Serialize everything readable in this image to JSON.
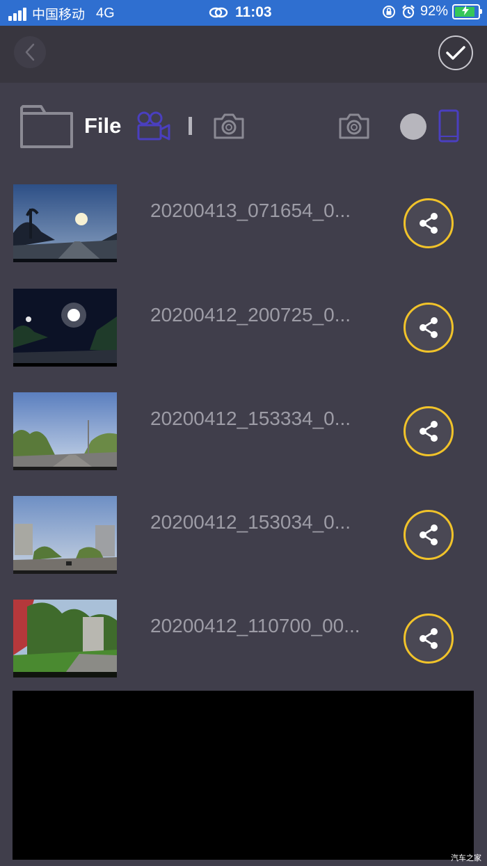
{
  "status_bar": {
    "carrier": "中国移动",
    "network": "4G",
    "time": "11:03",
    "battery": "92%",
    "battery_level": 0.92,
    "icons": [
      "signal-icon",
      "link-icon",
      "rotation-lock-icon",
      "alarm-icon",
      "battery-icon"
    ]
  },
  "nav": {
    "icons": [
      "back-chevron-icon",
      "checkmark-icon"
    ]
  },
  "toolbar": {
    "title": "File",
    "icons": [
      "folder-icon",
      "video-camera-icon",
      "camera-icon",
      "camera-icon",
      "toggle-dot",
      "phone-icon"
    ],
    "accent_color": "#4a3fbf"
  },
  "files": [
    {
      "name": "20200413_071654_0...",
      "thumb_scene": "dawn-road"
    },
    {
      "name": "20200412_200725_0...",
      "thumb_scene": "night-road"
    },
    {
      "name": "20200412_153334_0...",
      "thumb_scene": "daytime-road"
    },
    {
      "name": "20200412_153034_0...",
      "thumb_scene": "city-road"
    },
    {
      "name": "20200412_110700_00...",
      "thumb_scene": "green-street"
    }
  ],
  "share_icon": "share-icon",
  "share_color": "#f1c32a",
  "watermark": "汽车之家"
}
